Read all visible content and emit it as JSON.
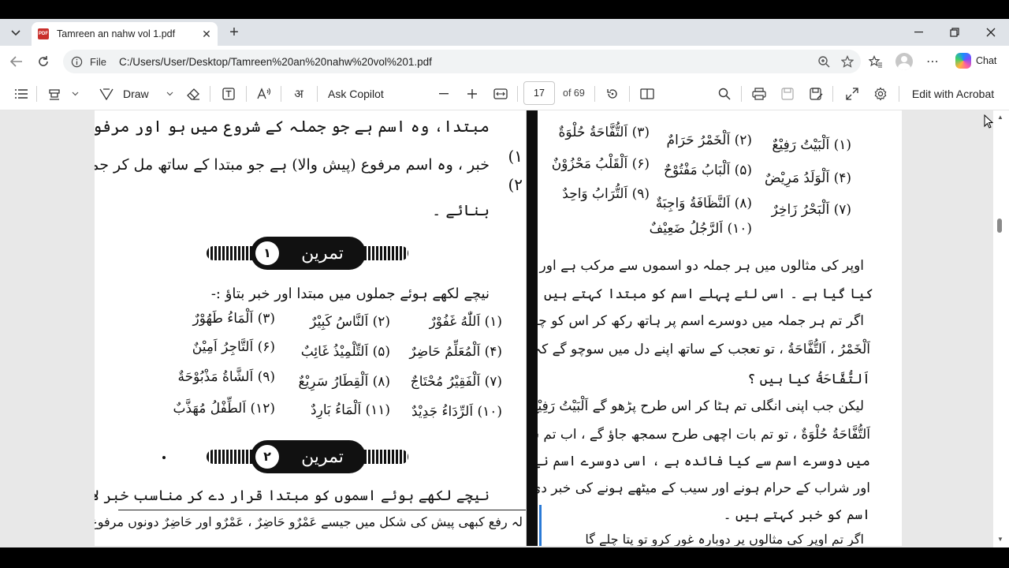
{
  "browser": {
    "tab_title": "Tamreen an nahw vol 1.pdf",
    "tab_badge": "PDF",
    "new_tab": "+",
    "address_label": "File",
    "url": "C:/Users/User/Desktop/Tamreen%20an%20nahw%20vol%201.pdf",
    "chat_label": "Chat"
  },
  "pdf_toolbar": {
    "draw_label": "Draw",
    "ask_copilot_label": "Ask Copilot",
    "page_current": "17",
    "page_total_label": "of 69",
    "edit_label": "Edit with Acrobat"
  },
  "left_page": {
    "lines": [
      "مبتدا، وہ اسم ہے جو جملہ کے شروع میں ہو اور مرفوع ہو ۔",
      "خبر ، وہ اسم مرفوع (پیش والا) ہے جو مبتدا کے ساتھ مل کر جملہ مفیدہ",
      "بنائے ۔"
    ],
    "numbers": [
      "۱)",
      "۲)"
    ],
    "exercise1_title": "تمرین",
    "exercise1_num": "۱",
    "exercise1_instruction": "نیچے لکھے ہوئے جملوں میں مبتدا اور خبر بتاؤ :-",
    "exercise1_rows": [
      [
        "(۱) اَللّٰهُ غَفُوْرٌ",
        "(۲) اَلنَّاسُ کَبِیْرٌ",
        "(۳) اَلْمَاءُ طَهُوْرٌ"
      ],
      [
        "(۴) اَلْمُعَلِّمُ حَاضِرٌ",
        "(۵) اَلتِّلْمِیْذُ غَائِبٌ",
        "(۶) اَلتَّاجِرُ اَمِیْنٌ"
      ],
      [
        "(۷) اَلْفَقِیْرُ مُحْتَاجٌ",
        "(۸) اَلْقِطَارُ سَرِیْعٌ",
        "(۹) اَلشَّاةُ مَذْبُوْحَةٌ"
      ],
      [
        "(۱۰) اَلرِّدَاءُ جَدِیْدٌ",
        "(۱۱) اَلْمَاءُ بَارِدٌ",
        "(۱۲) اَلطِّفْلُ مُهَذَّبٌ"
      ]
    ],
    "exercise2_title": "تمرین",
    "exercise2_num": "۲",
    "exercise2_instruction": "نیچے لکھے ہوئے اسموں کو مبتدا قرار دے کر مناسب خبر لاؤ ۔",
    "footnote": "لہ رفع کبھی پیش کی شکل میں جیسے عَمْرٌو حَاضِرٌ ، عَمْرٌو اور حَاضِرٌ دونوں مرفوع"
  },
  "right_page": {
    "examples": [
      [
        "(۱) اَلْبَیْتُ رَفِیْعٌ",
        "(۲) اَلْخَمْرُ حَرَامٌ",
        "(۳) اَلتُّفَّاحَةُ حُلْوَةٌ"
      ],
      [
        "(۴) اَلْوَلَدُ مَرِیْضٌ",
        "(۵) اَلْبَابُ مَفْتُوْحٌ",
        "(۶) اَلْقَلْبُ مَحْزُوْنٌ"
      ],
      [
        "(۷) اَلْبَحْرُ زَاخِرٌ",
        "(۸) اَلنَّظَافَةُ وَاجِبَةٌ",
        "(۹) اَلتُّرَابُ وَاحِدٌ"
      ],
      [
        "(۱۰) اَلرَّجُلُ ضَعِیْفٌ"
      ]
    ],
    "paragraph": [
      "اوپر کی مثالوں میں ہر جملہ دو اسموں سے مرکب ہے اور ہر جملہ اسم سے شروع",
      "کیا گیا ہے ۔ اسی لئے پہلے اسم کو مبتدا کہتے ہیں ۔",
      "اگر تم ہر جملہ میں دوسرے اسم پر ہاتھ رکھ کر اس کو چھپا لو اور یوں پڑھو اَلْبَیْتُ",
      "اَلْخَمْرُ ، اَلتُّفَّاحَةُ ، تو تعجب کے ساتھ اپنے دل میں سوچو گے کہ اَلْبَیْتُ ، اَلْخَمْرُ",
      "اَلتُّفَّاحَةُ کیا ہیں ؟",
      "لیکن جب اپنی انگلی تم ہٹا کر اس طرح پڑھو گے اَلْبَیْتُ رَفِیْعٌ ، اَلْخَمْرُ",
      "اَلتُّفَّاحَةُ حُلْوَةٌ ، تو تم بات اچھی طرح سمجھ جاؤ گے ، اب تم سمجھ گئے ہو گے کہ ہر جملہ",
      "میں دوسرے اسم سے کیا فائدہ ہے ، اسی دوسرے اسم نے تمھیں گھر کے بلند ہونے",
      "اور شراب کے حرام ہونے اور سیب کے میٹھے ہونے کی خبر دی ہے ، اسی لئے دوسرے",
      "اسم کو خبر کہتے ہیں ۔",
      "اگر تم اوپر کی مثالوں پر دوبارہ غور کرو تو پتا چلے گا"
    ]
  }
}
